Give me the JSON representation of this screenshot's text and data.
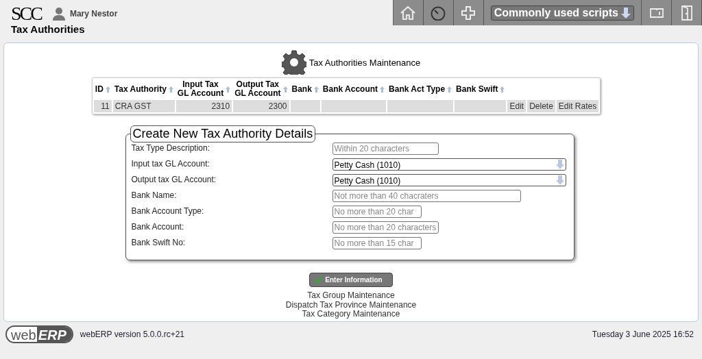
{
  "header": {
    "logo": "SCC",
    "user": "Mary Nestor",
    "page_title": "Tax Authorities",
    "scripts_menu": "Commonly used scripts"
  },
  "main": {
    "title": "Tax Authorities Maintenance",
    "table": {
      "columns": [
        {
          "lines": [
            "ID"
          ],
          "kind": "number"
        },
        {
          "lines": [
            "Tax Authority"
          ],
          "kind": "text"
        },
        {
          "lines": [
            "Input Tax",
            "GL Account"
          ],
          "kind": "number"
        },
        {
          "lines": [
            "Output Tax",
            "GL Account"
          ],
          "kind": "number"
        },
        {
          "lines": [
            "Bank"
          ],
          "kind": "text"
        },
        {
          "lines": [
            "Bank Account"
          ],
          "kind": "text"
        },
        {
          "lines": [
            "Bank Act Type"
          ],
          "kind": "text"
        },
        {
          "lines": [
            "Bank Swift"
          ],
          "kind": "text"
        }
      ],
      "rows": [
        {
          "id": "11",
          "authority": "CRA GST",
          "input_account": "2310",
          "output_account": "2300",
          "actions": [
            "Edit",
            "Delete",
            "Edit Rates"
          ]
        }
      ]
    },
    "form": {
      "legend": "Create New Tax Authority Details",
      "fields": [
        {
          "label": "Tax Type Description:",
          "kind": "input",
          "placeholder": "Within 20 characters"
        },
        {
          "label": "Input tax GL Account:",
          "kind": "select",
          "value": "Petty Cash (1010)"
        },
        {
          "label": "Output tax GL Account:",
          "kind": "select",
          "value": "Petty Cash (1010)"
        },
        {
          "label": "Bank Name:",
          "kind": "input",
          "placeholder": "Not more than 40 chacraters"
        },
        {
          "label": "Bank Account Type:",
          "kind": "input",
          "placeholder": "No more than 20 char"
        },
        {
          "label": "Bank Account:",
          "kind": "input",
          "placeholder": "No more than 20 characters"
        },
        {
          "label": "Bank Swift No:",
          "kind": "input",
          "placeholder": "No more than 15 char"
        }
      ]
    },
    "submit": "Enter Information",
    "links": [
      "Tax Group Maintenance",
      "Dispatch Tax Province Maintenance",
      "Tax Category Maintenance"
    ]
  },
  "footer": {
    "logo_left": "web",
    "logo_right": "ERP",
    "version": "webERP version 5.0.0.rc+21",
    "datetime": "Tuesday 3 June 2025 16:52"
  }
}
